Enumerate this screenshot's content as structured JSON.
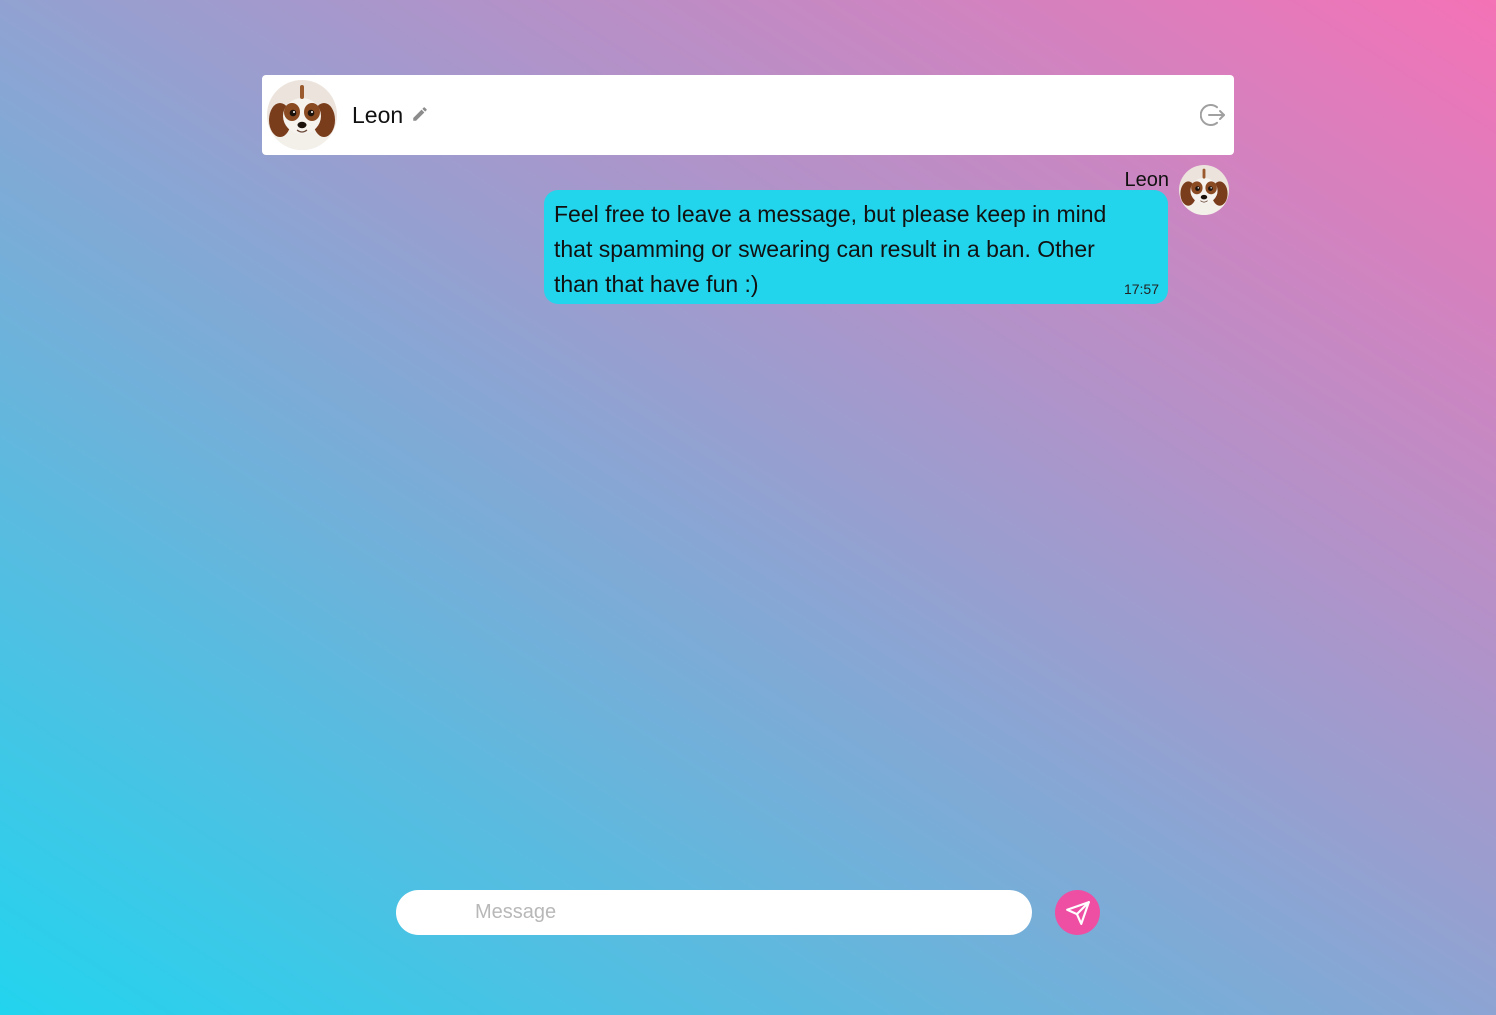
{
  "header": {
    "username": "Leon",
    "avatar": "dog-avatar",
    "edit_icon": "pencil-icon",
    "logout_icon": "logout-icon"
  },
  "messages": [
    {
      "sender": "Leon",
      "text": "Feel free to leave a message, but please keep in mind that spamming or swearing can result in a ban. Other than that have fun :)",
      "time": "17:57",
      "avatar": "dog-avatar"
    }
  ],
  "composer": {
    "placeholder": "Message",
    "value": "",
    "send_icon": "send-icon"
  },
  "colors": {
    "gradient_start": "#22d4ee",
    "gradient_end": "#f472b6",
    "bubble": "#22d4ec",
    "send_button": "#ee4fa3"
  }
}
